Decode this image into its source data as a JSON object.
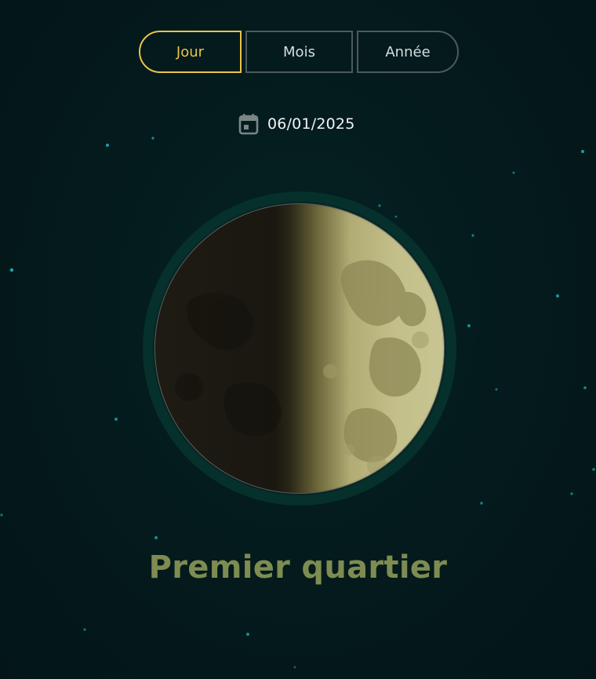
{
  "view_selector": {
    "options": [
      {
        "label": "Jour",
        "selected": true
      },
      {
        "label": "Mois",
        "selected": false
      },
      {
        "label": "Année",
        "selected": false
      }
    ]
  },
  "date_picker": {
    "icon": "calendar-icon",
    "value": "06/01/2025"
  },
  "moon": {
    "phase_name": "Premier quartier",
    "illuminated_side": "right"
  },
  "colors": {
    "background": "#041b1d",
    "accent_selected": "#e8c44a",
    "phase_title": "#7e8c52",
    "moon_ring": "#05302b"
  }
}
